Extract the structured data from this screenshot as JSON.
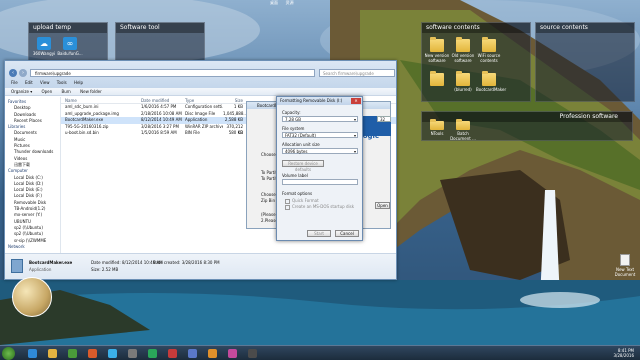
{
  "topbar": {
    "items": [
      "桌面",
      "资源"
    ]
  },
  "fences": {
    "upload_temp": {
      "title": "upload temp",
      "icons": [
        "360Wangyi",
        "BaiduYunG..."
      ]
    },
    "software_tool": {
      "title": "Software tool"
    },
    "software_contents": {
      "title": "software contents",
      "icons": [
        "New version software",
        "Old version software",
        "WiFi source contents",
        "",
        "(blurred)",
        "BootcardMaker"
      ]
    },
    "source_contents": {
      "title": "source contents"
    },
    "profession_software": {
      "title": "Profession software",
      "icons": [
        "NTools",
        "Batch Document ...",
        ""
      ]
    }
  },
  "explorer": {
    "address": "firmware\\upgrade",
    "search_placeholder": "Search firmware\\upgrade",
    "menu": [
      "File",
      "Edit",
      "View",
      "Tools",
      "Help"
    ],
    "commands": [
      "Organize ▾",
      "Open",
      "Burn",
      "New folder"
    ],
    "nav": {
      "favorites_label": "Favorites",
      "favorites": [
        "Desktop",
        "Downloads",
        "Recent Places"
      ],
      "libraries_label": "Libraries",
      "libraries": [
        "Documents",
        "Music",
        "Pictures",
        "Thunder downloads",
        "Videos",
        "迅雷下载"
      ],
      "computer_label": "Computer",
      "drives": [
        "Local Disk (C:)",
        "Local Disk (D:)",
        "Local Disk (E:)",
        "Local Disk (F:)",
        "Removable Disk",
        "TB-Android(1.2)",
        "mx-server (Y:) UBUNTU",
        "sp2 (\\\\Ubuntu)",
        "sp2 (\\\\Ubuntu)",
        "sr-sip (\\\\ZWMME"
      ],
      "network_label": "Network"
    },
    "columns": [
      "Name",
      "Date modified",
      "Type",
      "Size"
    ],
    "files": [
      {
        "name": "aml_sdc_burn.ini",
        "date": "1/6/2016 4:57 PM",
        "type": "Configuration setti...",
        "size": "1 KB"
      },
      {
        "name": "aml_upgrade_package.img",
        "date": "2/18/2016 10:08 AM",
        "type": "Disc Image File",
        "size": "1,045,888..."
      },
      {
        "name": "BootcardMaker.exe",
        "date": "8/12/2014 10:49 AM",
        "type": "Application",
        "size": "2,588 KB"
      },
      {
        "name": "T95-5G-20160316.zip",
        "date": "3/28/2016 3:27 PM",
        "type": "WinRAR ZIP archive",
        "size": "370,212 KB"
      },
      {
        "name": "u-boot.bin.sd.bin",
        "date": "1/5/2016 8:59 AM",
        "type": "BIN File",
        "size": "580 KB"
      }
    ],
    "details": {
      "name": "BootcardMaker.exe",
      "kind": "Application",
      "modified": "Date modified: 8/12/2014 10:49 AM",
      "created": "Date created: 3/28/2016 8:30 PM",
      "size": "Size: 2.52 MB"
    }
  },
  "bootapp": {
    "title": "BootcardMaker",
    "logo": "mlogic",
    "field_value": "32",
    "labels": [
      "Choose",
      "To Partit",
      "To Partit",
      "Choose",
      "Zip Bin",
      "(Please",
      "2.Please"
    ],
    "button": "Open"
  },
  "format_dialog": {
    "title": "Formatting Removable Disk (I:)",
    "capacity_label": "Capacity:",
    "capacity_value": "7.28 GB",
    "fs_label": "File system",
    "fs_value": "FAT32 (Default)",
    "alloc_label": "Allocation unit size",
    "alloc_value": "4096 bytes",
    "restore_button": "Restore device defaults",
    "volume_label": "Volume label",
    "volume_value": "",
    "options_label": "Format options",
    "quick_format": "Quick Format",
    "msdos_disk": "Create an MS-DOS startup disk",
    "start_button": "Start",
    "cancel_button": "Cancel"
  },
  "desktop_file": {
    "label": "New Text Document"
  },
  "tray": {
    "time": "8:41 PM",
    "date": "3/28/2016"
  }
}
